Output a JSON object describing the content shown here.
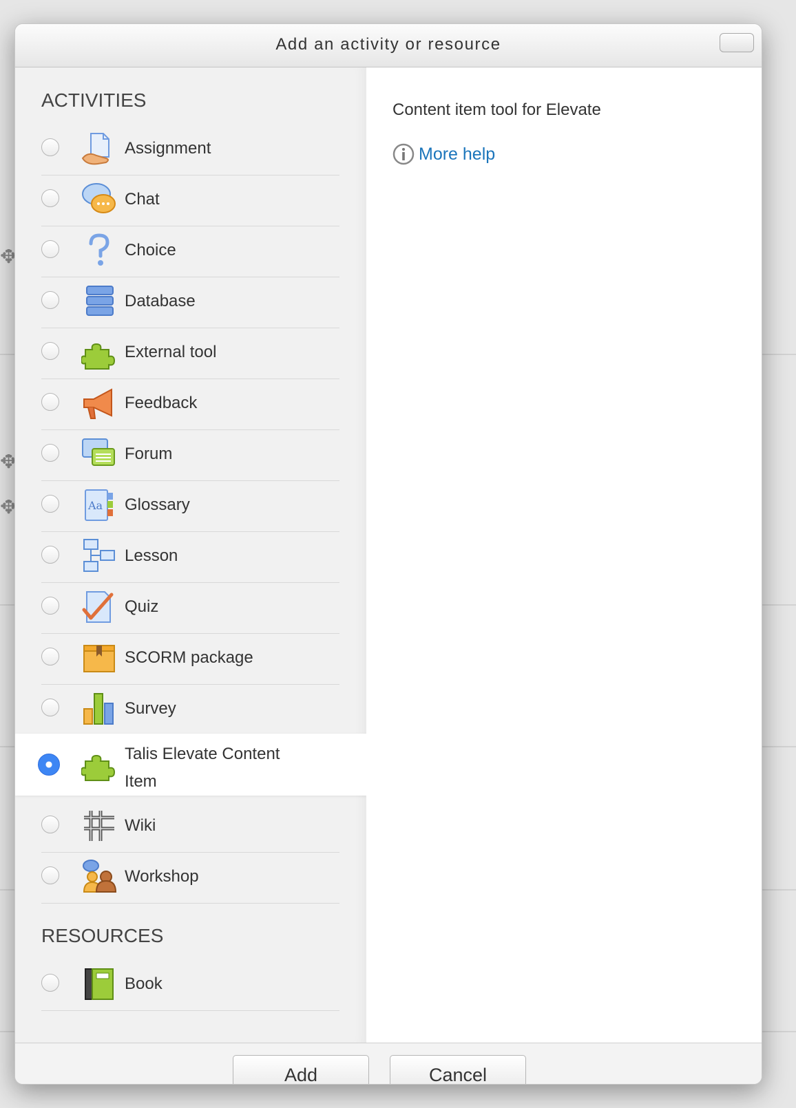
{
  "dialog": {
    "title": "Add an activity or resource"
  },
  "activities": {
    "heading": "ACTIVITIES",
    "items": [
      {
        "label": "Assignment",
        "icon": "assignment-icon"
      },
      {
        "label": "Chat",
        "icon": "chat-icon"
      },
      {
        "label": "Choice",
        "icon": "choice-icon"
      },
      {
        "label": "Database",
        "icon": "database-icon"
      },
      {
        "label": "External tool",
        "icon": "external-tool-icon"
      },
      {
        "label": "Feedback",
        "icon": "feedback-icon"
      },
      {
        "label": "Forum",
        "icon": "forum-icon"
      },
      {
        "label": "Glossary",
        "icon": "glossary-icon"
      },
      {
        "label": "Lesson",
        "icon": "lesson-icon"
      },
      {
        "label": "Quiz",
        "icon": "quiz-icon"
      },
      {
        "label": "SCORM package",
        "icon": "scorm-package-icon"
      },
      {
        "label": "Survey",
        "icon": "survey-icon"
      },
      {
        "label": "Talis Elevate Content Item",
        "icon": "talis-elevate-icon",
        "selected": true
      },
      {
        "label": "Wiki",
        "icon": "wiki-icon"
      },
      {
        "label": "Workshop",
        "icon": "workshop-icon"
      }
    ]
  },
  "resources": {
    "heading": "RESOURCES",
    "items": [
      {
        "label": "Book",
        "icon": "book-icon"
      }
    ]
  },
  "details": {
    "description": "Content item tool for Elevate",
    "help_label": "More help"
  },
  "footer": {
    "add_label": "Add",
    "cancel_label": "Cancel"
  },
  "colors": {
    "link": "#1b75bb",
    "selected_radio": "#3d86f4"
  }
}
